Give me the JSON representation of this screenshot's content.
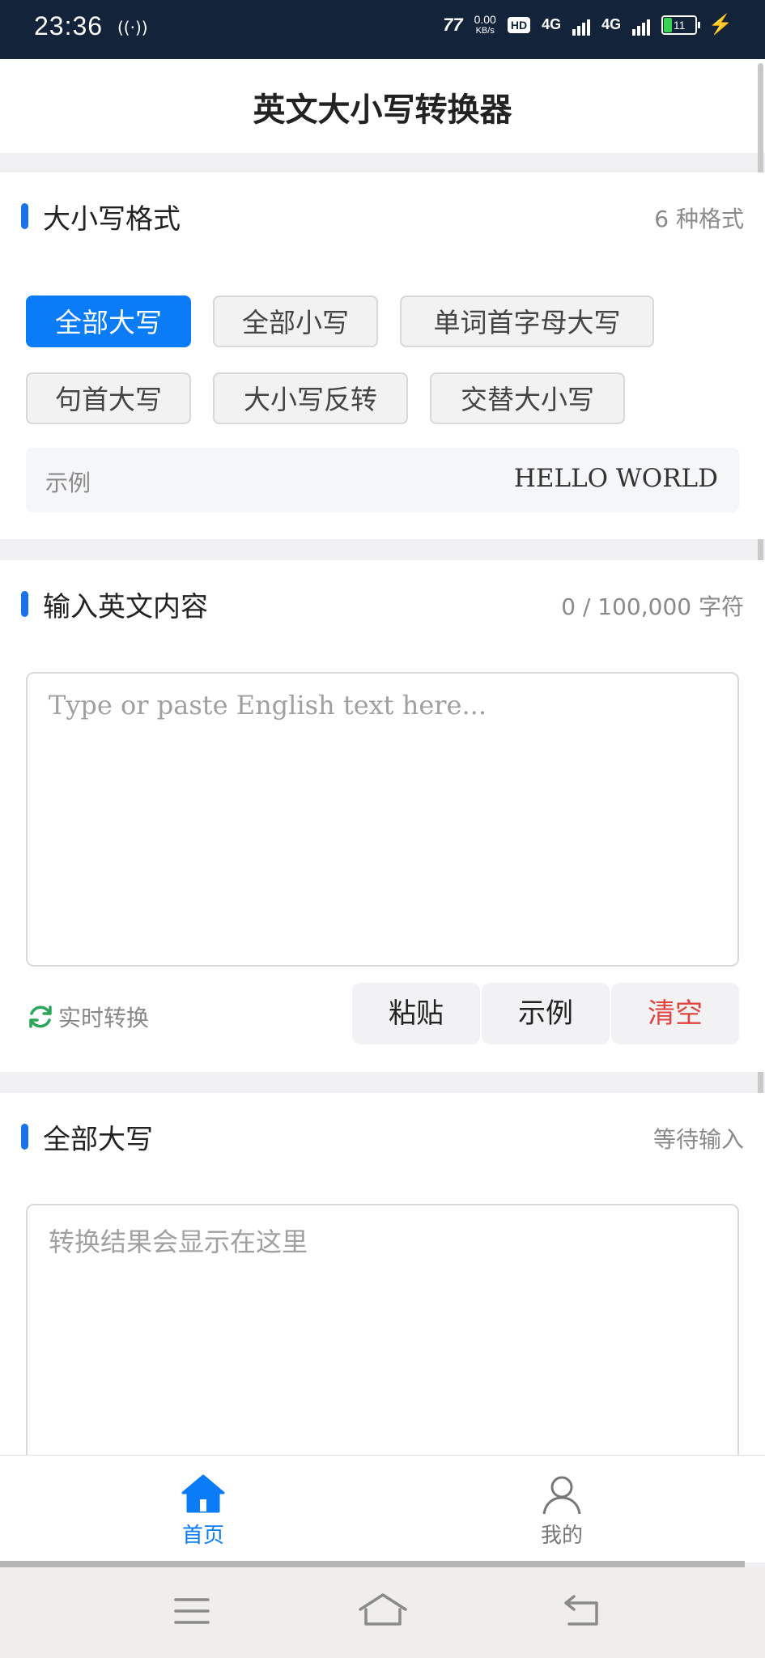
{
  "status_bar": {
    "time": "23:36",
    "net_speed_value": "0.00",
    "net_speed_unit": "KB/s",
    "hd_label": "HD",
    "sim1": "4G",
    "sim2": "4G",
    "battery": "11"
  },
  "header": {
    "title": "英文大小写转换器"
  },
  "format_section": {
    "title": "大小写格式",
    "count": "6 种格式",
    "chips": [
      "全部大写",
      "全部小写",
      "单词首字母大写",
      "句首大写",
      "大小写反转",
      "交替大小写"
    ],
    "selected": "全部大写",
    "example_label": "示例",
    "example_value": "HELLO WORLD"
  },
  "input_section": {
    "title": "输入英文内容",
    "counter": "0 / 100,000 字符",
    "placeholder": "Type or paste English text here...",
    "realtime_label": "实时转换",
    "buttons": {
      "paste": "粘贴",
      "example": "示例",
      "clear": "清空"
    }
  },
  "output_section": {
    "title": "全部大写",
    "status": "等待输入",
    "placeholder": "转换结果会显示在这里"
  },
  "tabbar": {
    "home": "首页",
    "mine": "我的"
  },
  "colors": {
    "accent": "#0a7cf8",
    "danger": "#e0443e",
    "status_bar": "#13233a"
  }
}
